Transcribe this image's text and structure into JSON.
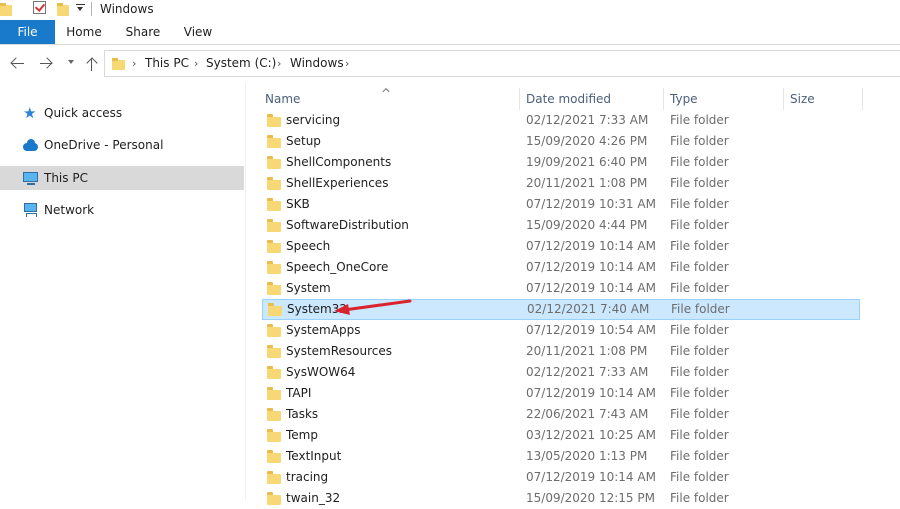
{
  "window": {
    "title": "Windows"
  },
  "ribbon": {
    "tabs": [
      "File",
      "Home",
      "Share",
      "View"
    ]
  },
  "address": {
    "crumbs": [
      "This PC",
      "System (C:)",
      "Windows"
    ]
  },
  "nav": {
    "items": [
      {
        "label": "Quick access",
        "icon": "star-icon"
      },
      {
        "label": "OneDrive - Personal",
        "icon": "cloud-icon"
      },
      {
        "label": "This PC",
        "icon": "pc-icon",
        "selected": true
      },
      {
        "label": "Network",
        "icon": "network-icon"
      }
    ]
  },
  "columns": {
    "name": "Name",
    "date": "Date modified",
    "type": "Type",
    "size": "Size"
  },
  "files": [
    {
      "name": "servicing",
      "date": "02/12/2021 7:33 AM",
      "type": "File folder"
    },
    {
      "name": "Setup",
      "date": "15/09/2020 4:26 PM",
      "type": "File folder"
    },
    {
      "name": "ShellComponents",
      "date": "19/09/2021 6:40 PM",
      "type": "File folder"
    },
    {
      "name": "ShellExperiences",
      "date": "20/11/2021 1:08 PM",
      "type": "File folder"
    },
    {
      "name": "SKB",
      "date": "07/12/2019 10:31 AM",
      "type": "File folder"
    },
    {
      "name": "SoftwareDistribution",
      "date": "15/09/2020 4:44 PM",
      "type": "File folder"
    },
    {
      "name": "Speech",
      "date": "07/12/2019 10:14 AM",
      "type": "File folder"
    },
    {
      "name": "Speech_OneCore",
      "date": "07/12/2019 10:14 AM",
      "type": "File folder"
    },
    {
      "name": "System",
      "date": "07/12/2019 10:14 AM",
      "type": "File folder"
    },
    {
      "name": "System32",
      "date": "02/12/2021 7:40 AM",
      "type": "File folder",
      "selected": true
    },
    {
      "name": "SystemApps",
      "date": "07/12/2019 10:54 AM",
      "type": "File folder"
    },
    {
      "name": "SystemResources",
      "date": "20/11/2021 1:08 PM",
      "type": "File folder"
    },
    {
      "name": "SysWOW64",
      "date": "02/12/2021 7:33 AM",
      "type": "File folder"
    },
    {
      "name": "TAPI",
      "date": "07/12/2019 10:14 AM",
      "type": "File folder"
    },
    {
      "name": "Tasks",
      "date": "22/06/2021 7:43 AM",
      "type": "File folder"
    },
    {
      "name": "Temp",
      "date": "03/12/2021 10:25 AM",
      "type": "File folder"
    },
    {
      "name": "TextInput",
      "date": "13/05/2020 1:13 PM",
      "type": "File folder"
    },
    {
      "name": "tracing",
      "date": "07/12/2019 10:14 AM",
      "type": "File folder"
    },
    {
      "name": "twain_32",
      "date": "15/09/2020 12:15 PM",
      "type": "File folder"
    }
  ],
  "annotation": {
    "color": "#d9232d",
    "target": "System32"
  }
}
